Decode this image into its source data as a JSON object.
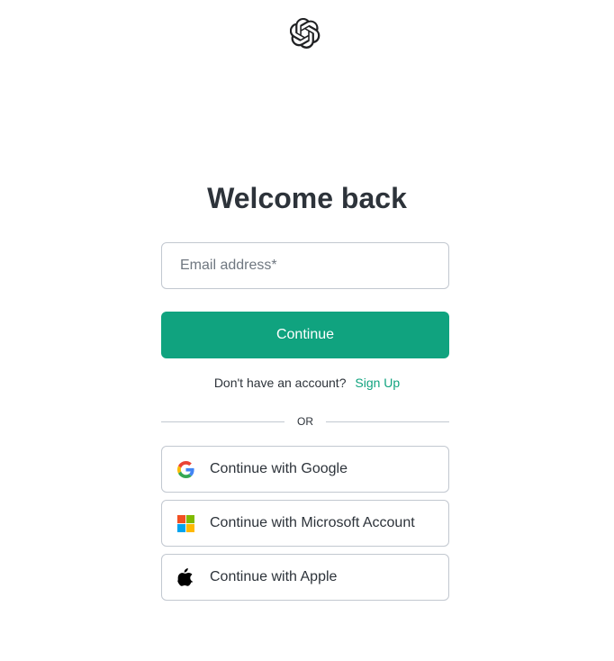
{
  "header": {
    "logo_icon": "openai-logo-icon"
  },
  "login": {
    "title": "Welcome back",
    "email_placeholder": "Email address*",
    "email_value": "",
    "continue_label": "Continue",
    "signup_prompt": "Don't have an account?",
    "signup_link": "Sign Up",
    "divider_text": "OR"
  },
  "social": [
    {
      "label": "Continue with Google",
      "icon": "google-icon"
    },
    {
      "label": "Continue with Microsoft Account",
      "icon": "microsoft-icon"
    },
    {
      "label": "Continue with Apple",
      "icon": "apple-icon"
    }
  ],
  "colors": {
    "accent": "#10a37f",
    "border": "#c2c8d0",
    "text": "#2d333a"
  }
}
